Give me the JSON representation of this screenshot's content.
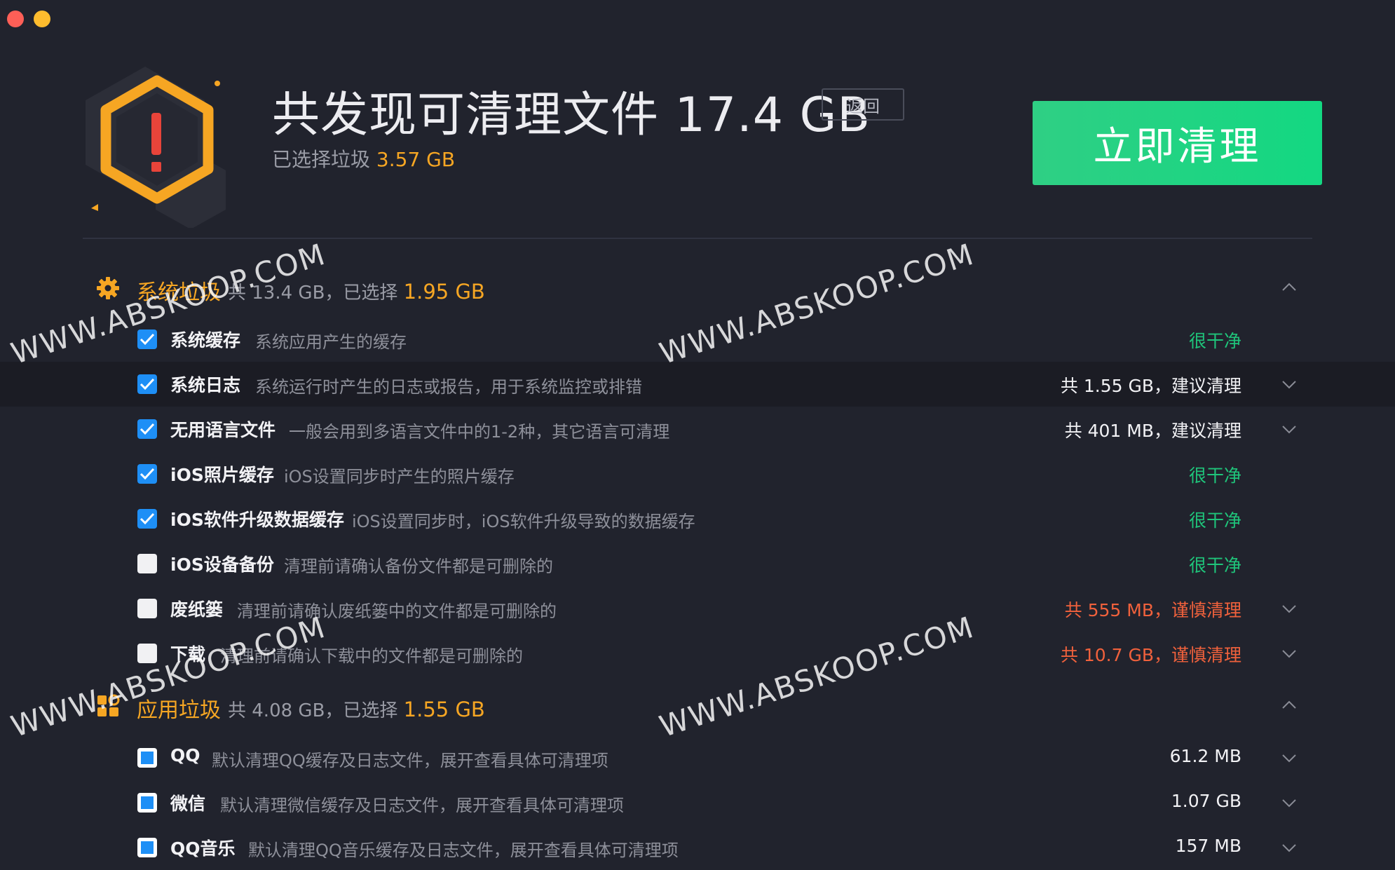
{
  "header": {
    "title": "共发现可清理文件 17.4 GB",
    "back_label": "返回",
    "selected_label": "已选择垃圾",
    "selected_value": "3.57 GB",
    "clean_button_label": "立即清理"
  },
  "sections": [
    {
      "title": "系统垃圾",
      "total": "共 13.4 GB，已选择",
      "selected": "1.95 GB",
      "icon": "gear-icon",
      "items": [
        {
          "name": "系统缓存",
          "desc": "系统应用产生的缓存",
          "status": "很干净",
          "checked": true
        },
        {
          "name": "系统日志",
          "desc": "系统运行时产生的日志或报告，用于系统监控或排错",
          "status": "共 1.55 GB，建议清理",
          "checked": true
        },
        {
          "name": "无用语言文件",
          "desc": "一般会用到多语言文件中的1-2种，其它语言可清理",
          "status": "共 401 MB，建议清理",
          "checked": true
        },
        {
          "name": "iOS照片缓存",
          "desc": "iOS设置同步时产生的照片缓存",
          "status": "很干净",
          "checked": true
        },
        {
          "name": "iOS软件升级数据缓存",
          "desc": "iOS设置同步时，iOS软件升级导致的数据缓存",
          "status": "很干净",
          "checked": true
        },
        {
          "name": "iOS设备备份",
          "desc": "清理前请确认备份文件都是可删除的",
          "status": "很干净",
          "checked": false
        },
        {
          "name": "废纸篓",
          "desc": "清理前请确认废纸篓中的文件都是可删除的",
          "status": "共 555 MB，谨慎清理",
          "checked": false
        },
        {
          "name": "下载",
          "desc": "清理前请确认下载中的文件都是可删除的",
          "status": "共 10.7 GB，谨慎清理",
          "checked": false
        }
      ]
    },
    {
      "title": "应用垃圾",
      "total": "共 4.08 GB，已选择",
      "selected": "1.55 GB",
      "icon": "apps-grid-icon",
      "items": [
        {
          "name": "QQ",
          "desc": "默认清理QQ缓存及日志文件，展开查看具体可清理项",
          "status": "61.2 MB",
          "checked": "partial"
        },
        {
          "name": "微信",
          "desc": "默认清理微信缓存及日志文件，展开查看具体可清理项",
          "status": "1.07 GB",
          "checked": "partial"
        },
        {
          "name": "QQ音乐",
          "desc": "默认清理QQ音乐缓存及日志文件，展开查看具体可清理项",
          "status": "157 MB",
          "checked": "partial"
        }
      ]
    }
  ],
  "watermark": "WWW.ABSKOOP.COM",
  "colors": {
    "background": "#21232d",
    "accent_orange": "#f6a623",
    "accent_green": "#1fc47a",
    "warning_red": "#f0613c",
    "checkbox_blue": "#1e8ff6",
    "clean_button": "#2fcf84"
  }
}
